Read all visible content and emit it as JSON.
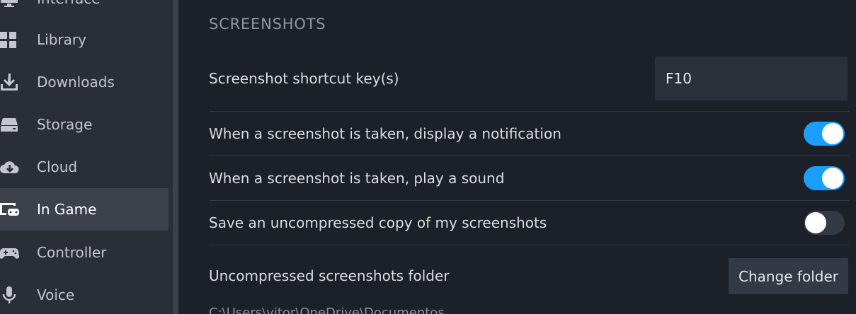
{
  "sidebar": {
    "items": [
      {
        "label": "Interface",
        "icon": "monitor-icon",
        "selected": false
      },
      {
        "label": "Library",
        "icon": "grid-icon",
        "selected": false
      },
      {
        "label": "Downloads",
        "icon": "download-icon",
        "selected": false
      },
      {
        "label": "Storage",
        "icon": "drive-icon",
        "selected": false
      },
      {
        "label": "Cloud",
        "icon": "cloud-download-icon",
        "selected": false
      },
      {
        "label": "In Game",
        "icon": "in-game-icon",
        "selected": true
      },
      {
        "label": "Controller",
        "icon": "gamepad-icon",
        "selected": false
      },
      {
        "label": "Voice",
        "icon": "microphone-icon",
        "selected": false
      }
    ]
  },
  "screenshots": {
    "title": "SCREENSHOTS",
    "shortcut_label": "Screenshot shortcut key(s)",
    "shortcut_value": "F10",
    "notify_label": "When a screenshot is taken, display a notification",
    "notify_on": true,
    "sound_label": "When a screenshot is taken, play a sound",
    "sound_on": true,
    "uncompressed_label": "Save an uncompressed copy of my screenshots",
    "uncompressed_on": false,
    "folder_label": "Uncompressed screenshots folder",
    "change_folder_label": "Change folder",
    "folder_path": "C:\\Users\\vitor\\OneDrive\\Documentos"
  },
  "colors": {
    "accent": "#1a9fff",
    "sidebar_bg": "#2a2e35",
    "sidebar_selected": "#3c414b",
    "main_bg": "#1b2029"
  }
}
